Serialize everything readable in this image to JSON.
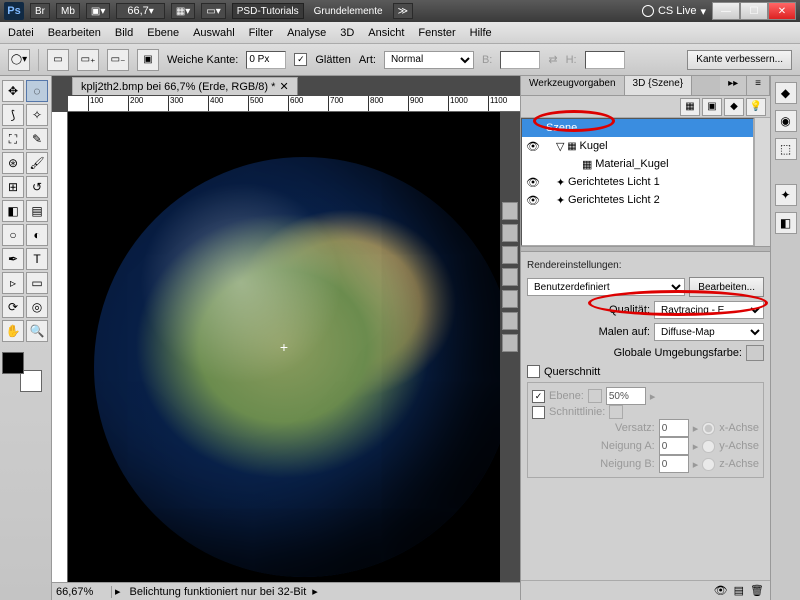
{
  "title_bar": {
    "ps": "Ps",
    "br": "Br",
    "mb": "Mb",
    "zoom_value": "66,7",
    "workspace1": "PSD-Tutorials",
    "workspace2": "Grundelemente",
    "cslive": "CS Live"
  },
  "menu": [
    "Datei",
    "Bearbeiten",
    "Bild",
    "Ebene",
    "Auswahl",
    "Filter",
    "Analyse",
    "3D",
    "Ansicht",
    "Fenster",
    "Hilfe"
  ],
  "options": {
    "weiche_kante_label": "Weiche Kante:",
    "weiche_kante_value": "0 Px",
    "glaetten": "Glätten",
    "art_label": "Art:",
    "art_value": "Normal",
    "b_label": "B:",
    "h_label": "H:",
    "improve": "Kante verbessern..."
  },
  "doc": {
    "tab": "kplj2th2.bmp bei 66,7% (Erde, RGB/8) *",
    "ruler": [
      "100",
      "200",
      "300",
      "400",
      "500",
      "600",
      "700",
      "800",
      "900",
      "1000",
      "1100"
    ]
  },
  "status": {
    "zoom": "66,67%",
    "msg": "Belichtung funktioniert nur bei 32-Bit"
  },
  "panel": {
    "tabs": [
      "Werkzeugvorgaben",
      "3D {Szene}"
    ],
    "scene": [
      {
        "label": "Szene",
        "indent": 0,
        "sel": true,
        "eye": ""
      },
      {
        "label": "Kugel",
        "indent": 1,
        "eye": "👁",
        "icon": "▽"
      },
      {
        "label": "Material_Kugel",
        "indent": 2,
        "eye": "",
        "icon": "▦"
      },
      {
        "label": "Gerichtetes Licht 1",
        "indent": 1,
        "eye": "👁",
        "icon": "✦"
      },
      {
        "label": "Gerichtetes Licht 2",
        "indent": 1,
        "eye": "👁",
        "icon": "✦"
      }
    ],
    "render_title": "Rendereinstellungen:",
    "render_preset": "Benutzerdefiniert",
    "edit": "Bearbeiten...",
    "quality_label": "Qualität:",
    "quality_value": "Raytracing - E...",
    "paint_label": "Malen auf:",
    "paint_value": "Diffuse-Map",
    "global_env": "Globale Umgebungsfarbe:",
    "cross_section": "Querschnitt",
    "cross": {
      "ebene": "Ebene:",
      "ebene_val": "50%",
      "schnitt": "Schnittlinie:",
      "versatz": "Versatz:",
      "versatz_val": "0",
      "neiga": "Neigung A:",
      "neiga_val": "0",
      "neigb": "Neigung B:",
      "neigb_val": "0",
      "x": "x-Achse",
      "y": "y-Achse",
      "z": "z-Achse"
    }
  }
}
